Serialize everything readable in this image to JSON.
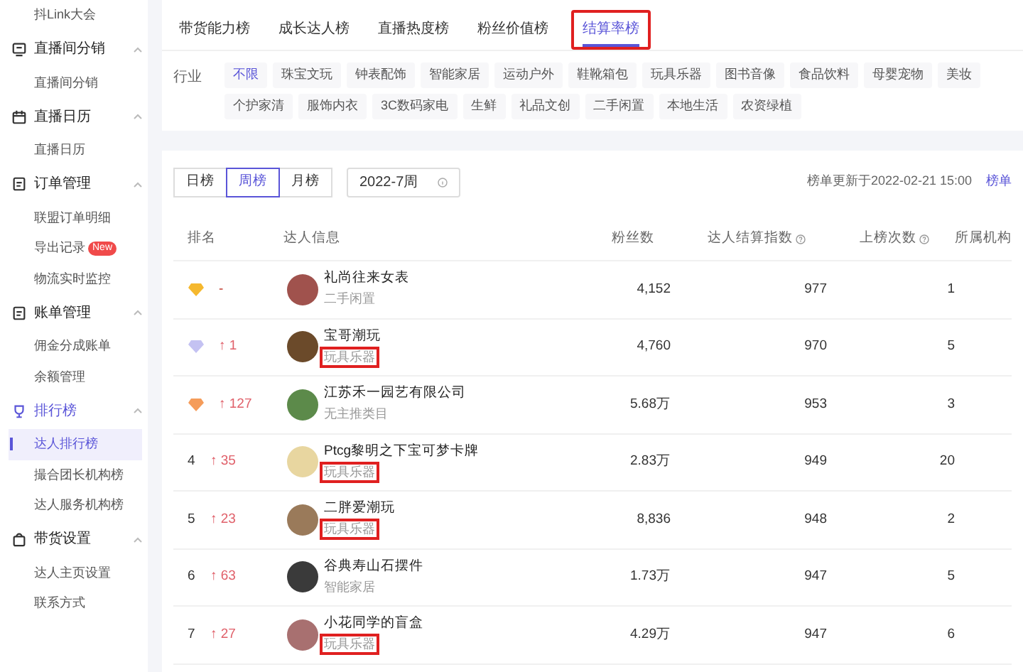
{
  "sidebar": {
    "items": [
      {
        "kind": "link",
        "label": "抖Link大会",
        "selected": false
      },
      {
        "kind": "group",
        "label": "直播间分销",
        "expanded": true,
        "selected": false
      },
      {
        "kind": "link",
        "label": "直播间分销",
        "selected": false
      },
      {
        "kind": "group",
        "label": "直播日历",
        "expanded": true,
        "selected": false
      },
      {
        "kind": "link",
        "label": "直播日历",
        "selected": false
      },
      {
        "kind": "group",
        "label": "订单管理",
        "expanded": true,
        "selected": false
      },
      {
        "kind": "link",
        "label": "联盟订单明细",
        "selected": false
      },
      {
        "kind": "link",
        "label": "导出记录",
        "badge": "New",
        "selected": false
      },
      {
        "kind": "link",
        "label": "物流实时监控",
        "selected": false
      },
      {
        "kind": "group",
        "label": "账单管理",
        "expanded": true,
        "selected": false
      },
      {
        "kind": "link",
        "label": "佣金分成账单",
        "selected": false
      },
      {
        "kind": "link",
        "label": "余额管理",
        "selected": false
      },
      {
        "kind": "group",
        "label": "排行榜",
        "expanded": true,
        "selected": true
      },
      {
        "kind": "link",
        "label": "达人排行榜",
        "selected": true
      },
      {
        "kind": "link",
        "label": "撮合团长机构榜",
        "selected": false
      },
      {
        "kind": "link",
        "label": "达人服务机构榜",
        "selected": false
      },
      {
        "kind": "group",
        "label": "带货设置",
        "expanded": true,
        "selected": false
      },
      {
        "kind": "link",
        "label": "达人主页设置",
        "selected": false
      },
      {
        "kind": "link",
        "label": "联系方式",
        "selected": false
      }
    ]
  },
  "tabs": [
    {
      "label": "带货能力榜",
      "selected": false,
      "highlighted": false
    },
    {
      "label": "成长达人榜",
      "selected": false,
      "highlighted": false
    },
    {
      "label": "直播热度榜",
      "selected": false,
      "highlighted": false
    },
    {
      "label": "粉丝价值榜",
      "selected": false,
      "highlighted": false
    },
    {
      "label": "结算率榜",
      "selected": true,
      "highlighted": true
    }
  ],
  "industry": {
    "label": "行业",
    "options": [
      {
        "label": "不限",
        "selected": true
      },
      {
        "label": "珠宝文玩",
        "selected": false
      },
      {
        "label": "钟表配饰",
        "selected": false
      },
      {
        "label": "智能家居",
        "selected": false
      },
      {
        "label": "运动户外",
        "selected": false
      },
      {
        "label": "鞋靴箱包",
        "selected": false
      },
      {
        "label": "玩具乐器",
        "selected": false
      },
      {
        "label": "图书音像",
        "selected": false
      },
      {
        "label": "食品饮料",
        "selected": false
      },
      {
        "label": "母婴宠物",
        "selected": false
      },
      {
        "label": "美妆",
        "selected": false
      },
      {
        "label": "个护家清",
        "selected": false
      },
      {
        "label": "服饰内衣",
        "selected": false
      },
      {
        "label": "3C数码家电",
        "selected": false
      },
      {
        "label": "生鲜",
        "selected": false
      },
      {
        "label": "礼品文创",
        "selected": false
      },
      {
        "label": "二手闲置",
        "selected": false
      },
      {
        "label": "本地生活",
        "selected": false
      },
      {
        "label": "农资绿植",
        "selected": false
      }
    ]
  },
  "period": [
    {
      "label": "日榜",
      "selected": false
    },
    {
      "label": "周榜",
      "selected": true
    },
    {
      "label": "月榜",
      "selected": false
    }
  ],
  "week_field": {
    "value": "2022-7周"
  },
  "updated": "榜单更新于2022-02-21 15:00",
  "rules_link": "榜单",
  "table": {
    "columns": [
      "排名",
      "达人信息",
      "粉丝数",
      "达人结算指数",
      "上榜次数",
      "所属机构"
    ],
    "rows": [
      {
        "color": "#f5b82e",
        "rank": "",
        "change": "-",
        "name": "礼尚往来女表",
        "category": "二手闲置",
        "category_highlighted": false,
        "fans": "4,152",
        "index": "977",
        "times": "1"
      },
      {
        "color": "#c4c2f2",
        "rank": "",
        "change": "↑ 1",
        "name": "宝哥潮玩",
        "category": "玩具乐器",
        "category_highlighted": true,
        "fans": "4,760",
        "index": "970",
        "times": "5"
      },
      {
        "color": "#f59c5a",
        "rank": "",
        "change": "↑ 127",
        "name": "江苏禾一园艺有限公司",
        "category": "无主推类目",
        "category_highlighted": false,
        "fans": "5.68万",
        "index": "953",
        "times": "3"
      },
      {
        "rank": "4",
        "change": "↑ 35",
        "name": "Ptcg黎明之下宝可梦卡牌",
        "category": "玩具乐器",
        "category_highlighted": true,
        "fans": "2.83万",
        "index": "949",
        "times": "20"
      },
      {
        "rank": "5",
        "change": "↑ 23",
        "name": "二胖爱潮玩",
        "category": "玩具乐器",
        "category_highlighted": true,
        "fans": "8,836",
        "index": "948",
        "times": "2"
      },
      {
        "rank": "6",
        "change": "↑ 63",
        "name": "谷典寿山石摆件",
        "category": "智能家居",
        "category_highlighted": false,
        "fans": "1.73万",
        "index": "947",
        "times": "5"
      },
      {
        "rank": "7",
        "change": "↑ 27",
        "name": "小花同学的盲盒",
        "category": "玩具乐器",
        "category_highlighted": true,
        "fans": "4.29万",
        "index": "947",
        "times": "6"
      }
    ]
  }
}
